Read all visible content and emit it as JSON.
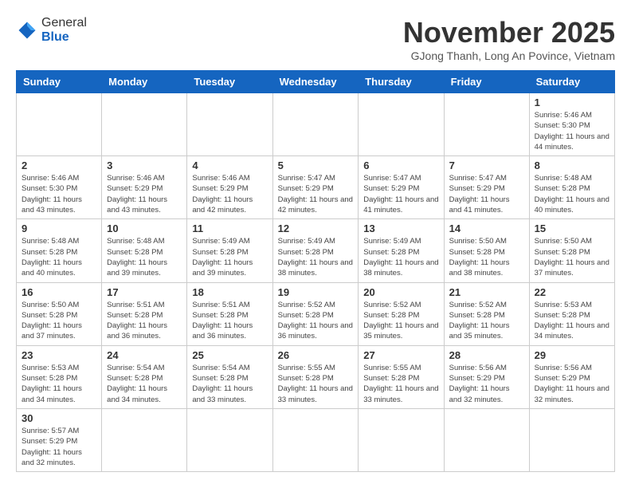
{
  "header": {
    "logo_general": "General",
    "logo_blue": "Blue",
    "month_title": "November 2025",
    "location": "GJong Thanh, Long An Povince, Vietnam"
  },
  "days_of_week": [
    "Sunday",
    "Monday",
    "Tuesday",
    "Wednesday",
    "Thursday",
    "Friday",
    "Saturday"
  ],
  "weeks": [
    [
      {
        "day": "",
        "info": ""
      },
      {
        "day": "",
        "info": ""
      },
      {
        "day": "",
        "info": ""
      },
      {
        "day": "",
        "info": ""
      },
      {
        "day": "",
        "info": ""
      },
      {
        "day": "",
        "info": ""
      },
      {
        "day": "1",
        "info": "Sunrise: 5:46 AM\nSunset: 5:30 PM\nDaylight: 11 hours\nand 44 minutes."
      }
    ],
    [
      {
        "day": "2",
        "info": "Sunrise: 5:46 AM\nSunset: 5:30 PM\nDaylight: 11 hours\nand 43 minutes."
      },
      {
        "day": "3",
        "info": "Sunrise: 5:46 AM\nSunset: 5:29 PM\nDaylight: 11 hours\nand 43 minutes."
      },
      {
        "day": "4",
        "info": "Sunrise: 5:46 AM\nSunset: 5:29 PM\nDaylight: 11 hours\nand 42 minutes."
      },
      {
        "day": "5",
        "info": "Sunrise: 5:47 AM\nSunset: 5:29 PM\nDaylight: 11 hours\nand 42 minutes."
      },
      {
        "day": "6",
        "info": "Sunrise: 5:47 AM\nSunset: 5:29 PM\nDaylight: 11 hours\nand 41 minutes."
      },
      {
        "day": "7",
        "info": "Sunrise: 5:47 AM\nSunset: 5:29 PM\nDaylight: 11 hours\nand 41 minutes."
      },
      {
        "day": "8",
        "info": "Sunrise: 5:48 AM\nSunset: 5:28 PM\nDaylight: 11 hours\nand 40 minutes."
      }
    ],
    [
      {
        "day": "9",
        "info": "Sunrise: 5:48 AM\nSunset: 5:28 PM\nDaylight: 11 hours\nand 40 minutes."
      },
      {
        "day": "10",
        "info": "Sunrise: 5:48 AM\nSunset: 5:28 PM\nDaylight: 11 hours\nand 39 minutes."
      },
      {
        "day": "11",
        "info": "Sunrise: 5:49 AM\nSunset: 5:28 PM\nDaylight: 11 hours\nand 39 minutes."
      },
      {
        "day": "12",
        "info": "Sunrise: 5:49 AM\nSunset: 5:28 PM\nDaylight: 11 hours\nand 38 minutes."
      },
      {
        "day": "13",
        "info": "Sunrise: 5:49 AM\nSunset: 5:28 PM\nDaylight: 11 hours\nand 38 minutes."
      },
      {
        "day": "14",
        "info": "Sunrise: 5:50 AM\nSunset: 5:28 PM\nDaylight: 11 hours\nand 38 minutes."
      },
      {
        "day": "15",
        "info": "Sunrise: 5:50 AM\nSunset: 5:28 PM\nDaylight: 11 hours\nand 37 minutes."
      }
    ],
    [
      {
        "day": "16",
        "info": "Sunrise: 5:50 AM\nSunset: 5:28 PM\nDaylight: 11 hours\nand 37 minutes."
      },
      {
        "day": "17",
        "info": "Sunrise: 5:51 AM\nSunset: 5:28 PM\nDaylight: 11 hours\nand 36 minutes."
      },
      {
        "day": "18",
        "info": "Sunrise: 5:51 AM\nSunset: 5:28 PM\nDaylight: 11 hours\nand 36 minutes."
      },
      {
        "day": "19",
        "info": "Sunrise: 5:52 AM\nSunset: 5:28 PM\nDaylight: 11 hours\nand 36 minutes."
      },
      {
        "day": "20",
        "info": "Sunrise: 5:52 AM\nSunset: 5:28 PM\nDaylight: 11 hours\nand 35 minutes."
      },
      {
        "day": "21",
        "info": "Sunrise: 5:52 AM\nSunset: 5:28 PM\nDaylight: 11 hours\nand 35 minutes."
      },
      {
        "day": "22",
        "info": "Sunrise: 5:53 AM\nSunset: 5:28 PM\nDaylight: 11 hours\nand 34 minutes."
      }
    ],
    [
      {
        "day": "23",
        "info": "Sunrise: 5:53 AM\nSunset: 5:28 PM\nDaylight: 11 hours\nand 34 minutes."
      },
      {
        "day": "24",
        "info": "Sunrise: 5:54 AM\nSunset: 5:28 PM\nDaylight: 11 hours\nand 34 minutes."
      },
      {
        "day": "25",
        "info": "Sunrise: 5:54 AM\nSunset: 5:28 PM\nDaylight: 11 hours\nand 33 minutes."
      },
      {
        "day": "26",
        "info": "Sunrise: 5:55 AM\nSunset: 5:28 PM\nDaylight: 11 hours\nand 33 minutes."
      },
      {
        "day": "27",
        "info": "Sunrise: 5:55 AM\nSunset: 5:28 PM\nDaylight: 11 hours\nand 33 minutes."
      },
      {
        "day": "28",
        "info": "Sunrise: 5:56 AM\nSunset: 5:29 PM\nDaylight: 11 hours\nand 32 minutes."
      },
      {
        "day": "29",
        "info": "Sunrise: 5:56 AM\nSunset: 5:29 PM\nDaylight: 11 hours\nand 32 minutes."
      }
    ],
    [
      {
        "day": "30",
        "info": "Sunrise: 5:57 AM\nSunset: 5:29 PM\nDaylight: 11 hours\nand 32 minutes."
      },
      {
        "day": "",
        "info": ""
      },
      {
        "day": "",
        "info": ""
      },
      {
        "day": "",
        "info": ""
      },
      {
        "day": "",
        "info": ""
      },
      {
        "day": "",
        "info": ""
      },
      {
        "day": "",
        "info": ""
      }
    ]
  ]
}
